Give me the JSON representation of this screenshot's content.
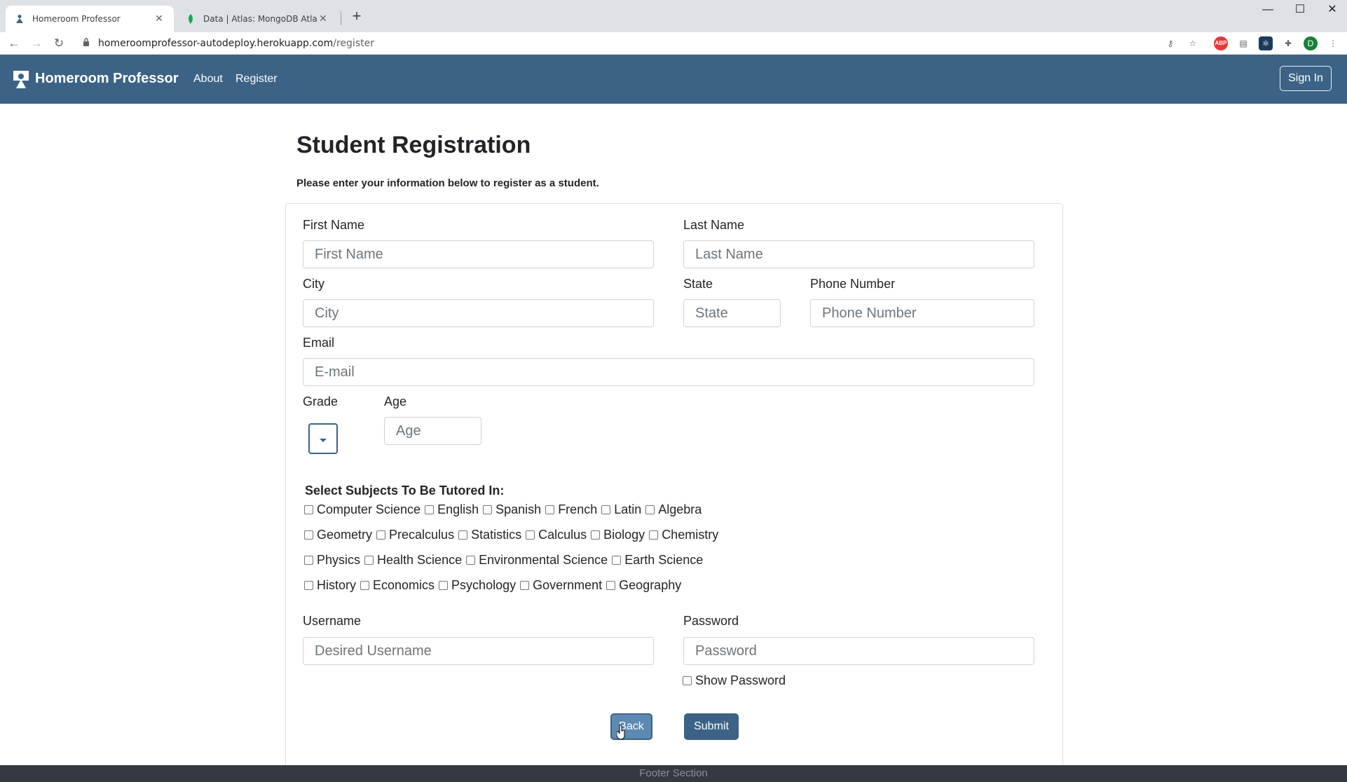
{
  "browser": {
    "tabs": [
      {
        "title": "Homeroom Professor",
        "active": true
      },
      {
        "title": "Data | Atlas: MongoDB Atlas",
        "active": false
      }
    ],
    "url_host": "homeroomprofessor-autodeploy.herokuapp.com",
    "url_path": "/register",
    "profile_initial": "D"
  },
  "navbar": {
    "brand": "Homeroom Professor",
    "links": [
      "About",
      "Register"
    ],
    "signin": "Sign In"
  },
  "page": {
    "title": "Student Registration",
    "subtitle": "Please enter your information below to register as a student."
  },
  "form": {
    "first_name": {
      "label": "First Name",
      "placeholder": "First Name"
    },
    "last_name": {
      "label": "Last Name",
      "placeholder": "Last Name"
    },
    "city": {
      "label": "City",
      "placeholder": "City"
    },
    "state": {
      "label": "State",
      "placeholder": "State"
    },
    "phone": {
      "label": "Phone Number",
      "placeholder": "Phone Number"
    },
    "email": {
      "label": "Email",
      "placeholder": "E-mail"
    },
    "grade": {
      "label": "Grade"
    },
    "age": {
      "label": "Age",
      "placeholder": "Age"
    },
    "subjects_title": "Select Subjects To Be Tutored In:",
    "subjects": [
      [
        "Computer Science",
        "English",
        "Spanish",
        "French",
        "Latin",
        "Algebra"
      ],
      [
        "Geometry",
        "Precalculus",
        "Statistics",
        "Calculus",
        "Biology",
        "Chemistry"
      ],
      [
        "Physics",
        "Health Science",
        "Environmental Science",
        "Earth Science"
      ],
      [
        "History",
        "Economics",
        "Psychology",
        "Government",
        "Geography"
      ]
    ],
    "username": {
      "label": "Username",
      "placeholder": "Desired Username"
    },
    "password": {
      "label": "Password",
      "placeholder": "Password"
    },
    "show_password": "Show Password",
    "back": "Back",
    "submit": "Submit"
  },
  "footer": "Footer Section",
  "colors": {
    "navbar": "#3c6385",
    "footer": "#343a40"
  }
}
